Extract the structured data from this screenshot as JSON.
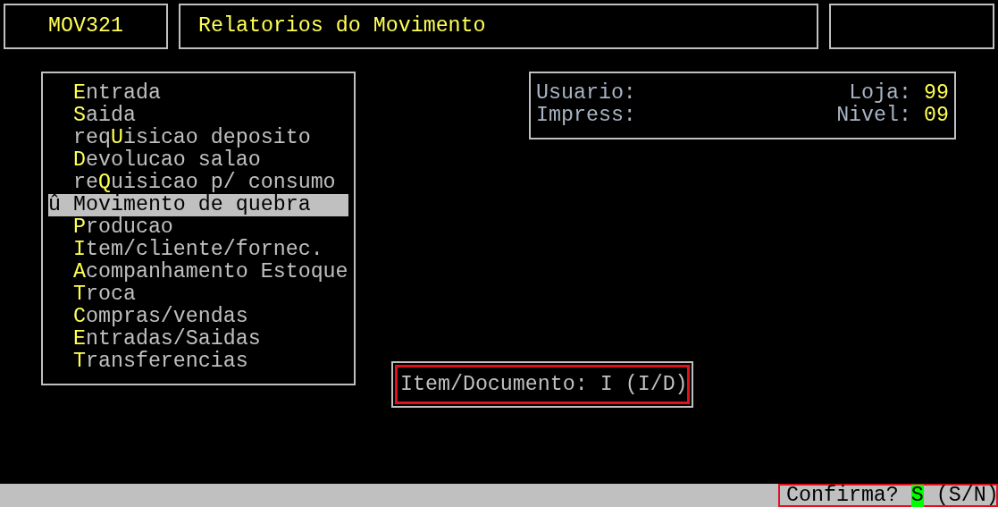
{
  "header": {
    "program_code": "MOV321",
    "title": "Relatorios do Movimento"
  },
  "menu": {
    "items": [
      {
        "hotkey": "E",
        "after": "ntrada",
        "selected": false
      },
      {
        "hotkey": "S",
        "after": "aida",
        "selected": false
      },
      {
        "before": "req",
        "hotkey": "U",
        "after": "isicao deposito",
        "selected": false
      },
      {
        "hotkey": "D",
        "after": "evolucao salao",
        "selected": false
      },
      {
        "before": "re",
        "hotkey": "Q",
        "after": "uisicao p/ consumo",
        "selected": false
      },
      {
        "marker": "û",
        "after": "Movimento de quebra",
        "selected": true
      },
      {
        "hotkey": "P",
        "after": "roducao",
        "selected": false
      },
      {
        "hotkey": "I",
        "after": "tem/cliente/fornec.",
        "selected": false
      },
      {
        "hotkey": "A",
        "after": "companhamento Estoque",
        "selected": false
      },
      {
        "hotkey": "T",
        "after": "roca",
        "selected": false
      },
      {
        "hotkey": "C",
        "after": "ompras/vendas",
        "selected": false
      },
      {
        "hotkey": "E",
        "after": "ntradas/Saidas",
        "selected": false
      },
      {
        "hotkey": "T",
        "after": "ransferencias",
        "selected": false
      }
    ]
  },
  "info": {
    "rows": [
      {
        "left_label": "Usuario:",
        "right_label": "Loja:",
        "right_value": "99"
      },
      {
        "left_label": "Impress:",
        "right_label": "Nivel:",
        "right_value": "09"
      }
    ]
  },
  "item_documento": {
    "label": "Item/Documento:",
    "value": "I",
    "options": "(I/D)"
  },
  "status_bar": {
    "prompt": "Confirma?",
    "value": "S",
    "options": "(S/N)"
  }
}
